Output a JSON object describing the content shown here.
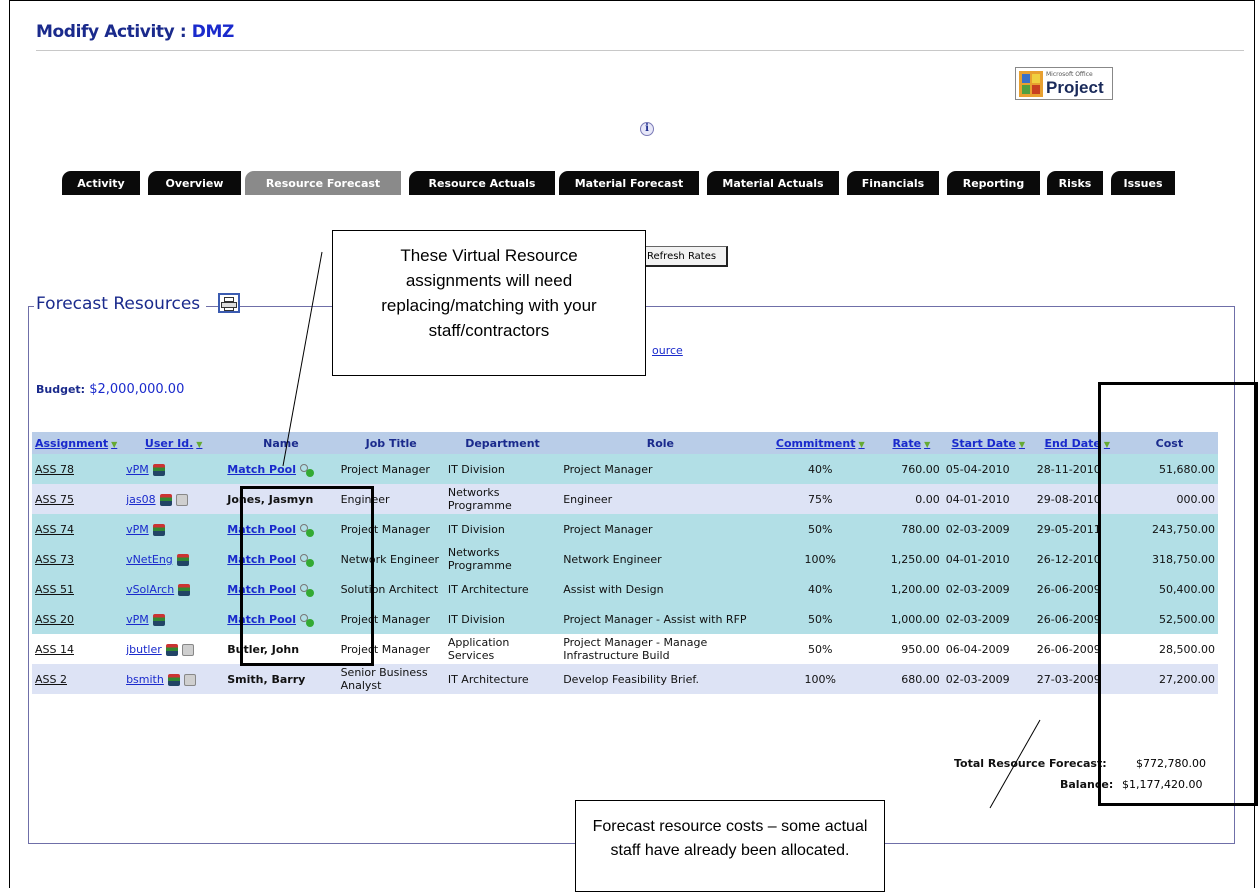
{
  "page": {
    "title_prefix": "Modify Activity",
    "title_sep": " : ",
    "title_activity": "DMZ"
  },
  "ms_project": {
    "small": "Microsoft Office",
    "big": "Project"
  },
  "info_icon": "i",
  "tabs": [
    {
      "label": "Activity",
      "active": false
    },
    {
      "label": "Overview",
      "active": false
    },
    {
      "label": "Resource Forecast",
      "active": true
    },
    {
      "label": "Resource Actuals",
      "active": false
    },
    {
      "label": "Material Forecast",
      "active": false
    },
    {
      "label": "Material Actuals",
      "active": false
    },
    {
      "label": "Financials",
      "active": false
    },
    {
      "label": "Reporting",
      "active": false
    },
    {
      "label": "Risks",
      "active": false
    },
    {
      "label": "Issues",
      "active": false
    }
  ],
  "refresh_button": "Refresh Rates",
  "section": {
    "legend": "Forecast Resources",
    "resource_link": "ource",
    "budget_label": "Budget:",
    "budget_value": "$2,000,000.00"
  },
  "table": {
    "headers": [
      "Assignment",
      "User Id.",
      "Name",
      "Job Title",
      "Department",
      "Role",
      "Commitment",
      "Rate",
      "Start Date",
      "End Date",
      "Cost"
    ],
    "rows": [
      {
        "assignment": "ASS 78",
        "user": "vPM",
        "name": "Match Pool",
        "match": true,
        "job": "Project Manager",
        "dept": "IT Division",
        "role": "Project Manager",
        "commit": "40%",
        "rate": "760.00",
        "start": "05-04-2010",
        "end": "28-11-2010",
        "cost": "51,680.00"
      },
      {
        "assignment": "ASS 75",
        "user": "jas08",
        "name": "Jones, Jasmyn",
        "match": false,
        "job": "Engineer",
        "dept": "Networks Programme",
        "role": "Engineer",
        "commit": "75%",
        "rate": "0.00",
        "start": "04-01-2010",
        "end": "29-08-2010",
        "cost": "000.00"
      },
      {
        "assignment": "ASS 74",
        "user": "vPM",
        "name": "Match Pool",
        "match": true,
        "job": "Project Manager",
        "dept": "IT Division",
        "role": "Project Manager",
        "commit": "50%",
        "rate": "780.00",
        "start": "02-03-2009",
        "end": "29-05-2011",
        "cost": "243,750.00"
      },
      {
        "assignment": "ASS 73",
        "user": "vNetEng",
        "name": "Match Pool",
        "match": true,
        "job": "Network Engineer",
        "dept": "Networks Programme",
        "role": "Network Engineer",
        "commit": "100%",
        "rate": "1,250.00",
        "start": "04-01-2010",
        "end": "26-12-2010",
        "cost": "318,750.00"
      },
      {
        "assignment": "ASS 51",
        "user": "vSolArch",
        "name": "Match Pool",
        "match": true,
        "job": "Solution Architect",
        "dept": "IT Architecture",
        "role": "Assist with Design",
        "commit": "40%",
        "rate": "1,200.00",
        "start": "02-03-2009",
        "end": "26-06-2009",
        "cost": "50,400.00"
      },
      {
        "assignment": "ASS 20",
        "user": "vPM",
        "name": "Match Pool",
        "match": true,
        "job": "Project Manager",
        "dept": "IT Division",
        "role": "Project Manager - Assist with RFP",
        "commit": "50%",
        "rate": "1,000.00",
        "start": "02-03-2009",
        "end": "26-06-2009",
        "cost": "52,500.00"
      },
      {
        "assignment": "ASS 14",
        "user": "jbutler",
        "name": "Butler, John",
        "match": false,
        "job": "Project Manager",
        "dept": "Application Services",
        "role": "Project Manager - Manage Infrastructure Build",
        "commit": "50%",
        "rate": "950.00",
        "start": "06-04-2009",
        "end": "26-06-2009",
        "cost": "28,500.00"
      },
      {
        "assignment": "ASS 2",
        "user": "bsmith",
        "name": "Smith, Barry",
        "match": false,
        "job": "Senior Business Analyst",
        "dept": "IT Architecture",
        "role": "Develop Feasibility Brief.",
        "commit": "100%",
        "rate": "680.00",
        "start": "02-03-2009",
        "end": "27-03-2009",
        "cost": "27,200.00"
      }
    ]
  },
  "totals": {
    "forecast_label": "Total Resource Forecast:",
    "forecast_value": "$772,780.00",
    "balance_label": "Balance:",
    "balance_value": "$1,177,420.00"
  },
  "callouts": {
    "virtual": "These Virtual Resource assignments will need replacing/matching with your staff/contractors",
    "forecast": "Forecast resource costs – some actual staff have already been allocated."
  }
}
